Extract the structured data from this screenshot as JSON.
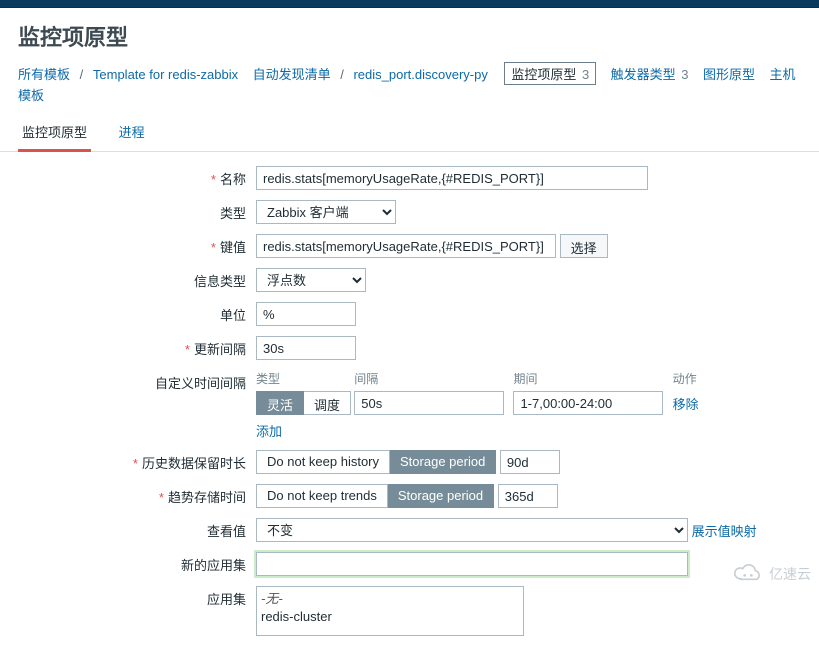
{
  "page": {
    "title": "监控项原型"
  },
  "breadcrumb": {
    "all_templates": "所有模板",
    "template_name": "Template for redis-zabbix",
    "discovery_list": "自动发现清单",
    "discovery_rule": "redis_port.discovery-py",
    "tabs": {
      "item_proto": "监控项原型",
      "item_proto_count": "3",
      "trigger_proto": "触发器类型",
      "trigger_proto_count": "3",
      "graph_proto": "图形原型",
      "host_proto": "主机模板"
    }
  },
  "subtabs": {
    "item_proto": "监控项原型",
    "process": "进程"
  },
  "labels": {
    "name": "名称",
    "type": "类型",
    "key": "键值",
    "info_type": "信息类型",
    "unit": "单位",
    "update": "更新间隔",
    "custom_interval": "自定义时间间隔",
    "history": "历史数据保留时长",
    "trends": "趋势存储时间",
    "show_value": "查看值",
    "new_app": "新的应用集",
    "app": "应用集"
  },
  "buttons": {
    "select": "选择",
    "add": "添加",
    "remove": "移除",
    "show_value_map": "展示值映射"
  },
  "values": {
    "name": "redis.stats[memoryUsageRate,{#REDIS_PORT}]",
    "type_selected": "Zabbix 客户端",
    "key": "redis.stats[memoryUsageRate,{#REDIS_PORT}]",
    "info_type_selected": "浮点数",
    "unit": "%",
    "update": "30s",
    "history_period": "90d",
    "trends_period": "365d",
    "show_value_selected": "不变",
    "new_app": ""
  },
  "custom_interval": {
    "headers": {
      "type": "类型",
      "interval": "间隔",
      "period": "期间",
      "action": "动作"
    },
    "row": {
      "flex": "灵活",
      "sched": "调度",
      "interval": "50s",
      "period": "1-7,00:00-24:00"
    }
  },
  "history_seg": {
    "no_keep": "Do not keep history",
    "storage": "Storage period"
  },
  "trends_seg": {
    "no_keep": "Do not keep trends",
    "storage": "Storage period"
  },
  "apps": {
    "none": "-无-",
    "opt1": "redis-cluster"
  },
  "watermark": "亿速云"
}
